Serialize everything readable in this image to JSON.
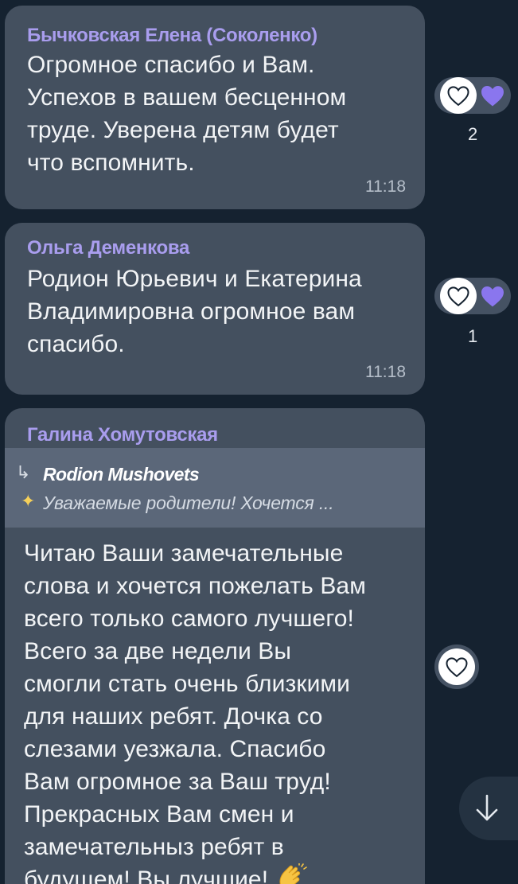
{
  "messages": [
    {
      "sender": "Бычковская Елена (Соколенко)",
      "lines": [
        "Огромное спасибо и Вам.",
        "Успехов в вашем бесценном",
        "труде. Уверена детям будет",
        "что вспомнить."
      ],
      "time": "11:18",
      "reaction": {
        "icon": "purple-heart-icon",
        "count": "2"
      }
    },
    {
      "sender": "Ольга Деменкова",
      "lines": [
        "Родион Юрьевич и Екатерина",
        "Владимировна огромное вам",
        "спасибо."
      ],
      "time": "11:18",
      "reaction": {
        "icon": "purple-heart-icon",
        "count": "1"
      }
    },
    {
      "sender": "Галина Хомутовская",
      "reply": {
        "author": "Rodion Mushovets",
        "preview": "Уважаемые родители! Хочется ..."
      },
      "lines": [
        "Читаю Ваши замечательные",
        "слова и хочется пожелать Вам",
        "всего только самого лучшего!",
        "Всего за две недели Вы",
        "смогли стать очень близкими",
        "для наших ребят. Дочка со",
        "слезами уезжала. Спасибо",
        "Вам огромное за Ваш труд!",
        "Прекрасных Вам смен и",
        "замечательныз ребят в",
        "будущем! Вы лучшие!"
      ],
      "trailing_icon": "clapping-hands-icon"
    }
  ],
  "colors": {
    "background": "#152230",
    "bubble": "#44505f",
    "sender": "#a99dee",
    "heart": "#8a76ee"
  }
}
